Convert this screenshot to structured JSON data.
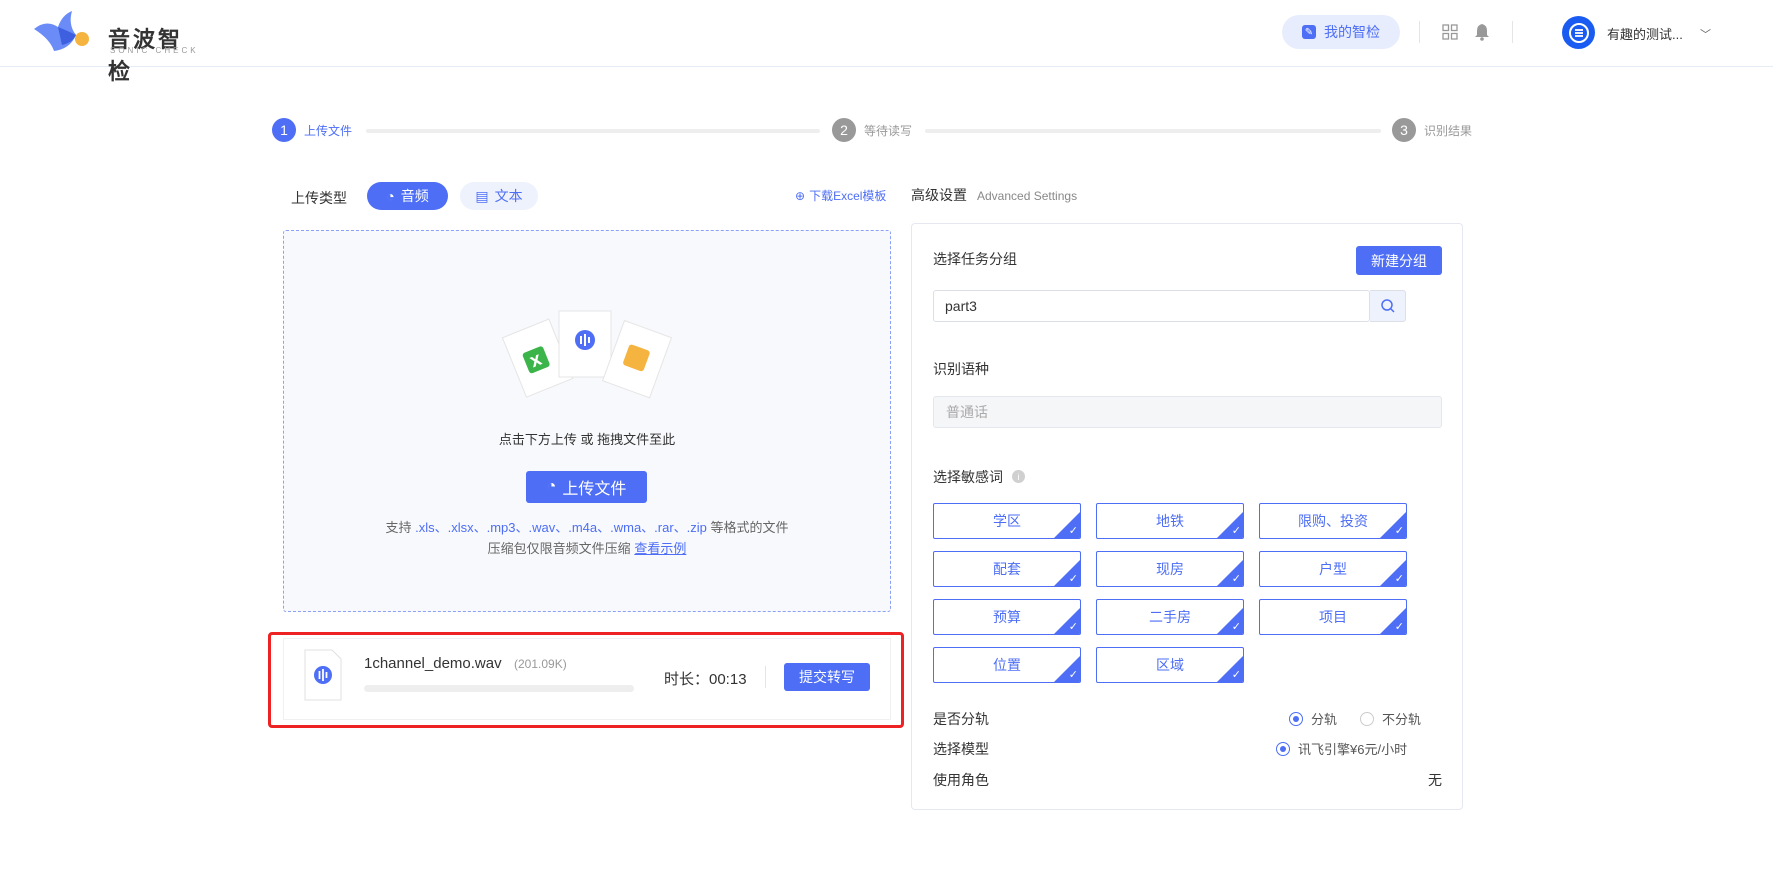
{
  "header": {
    "logo_title": "音波智检",
    "logo_subtitle": "SONIC CHECK",
    "my_button": "我的智检",
    "user_name": "有趣的测试..."
  },
  "steps": [
    {
      "num": "1",
      "label": "上传文件"
    },
    {
      "num": "2",
      "label": "等待读写"
    },
    {
      "num": "3",
      "label": "识别结果"
    }
  ],
  "upload": {
    "type_label": "上传类型",
    "type_audio": "音频",
    "type_text": "文本",
    "download_template": "下载Excel模板",
    "drop_hint": "点击下方上传 或 拖拽文件至此",
    "upload_button": "上传文件",
    "support_prefix": "支持",
    "support_formats": ".xls、.xlsx、.mp3、.wav、.m4a、.wma、.rar、.zip",
    "support_suffix": "等格式的文件",
    "compress_note": "压缩包仅限音频文件压缩",
    "view_example": "查看示例"
  },
  "file": {
    "name": "1channel_demo.wav",
    "size": "(201.09K)",
    "duration": "时长：00:13",
    "submit_button": "提交转写"
  },
  "advanced": {
    "title": "高级设置",
    "title_en": "Advanced Settings",
    "group_label": "选择任务分组",
    "new_group_button": "新建分组",
    "group_value": "part3",
    "lang_label": "识别语种",
    "lang_placeholder": "普通话",
    "sensitive_label": "选择敏感词",
    "tags": [
      "学区",
      "地铁",
      "限购、投资",
      "配套",
      "现房",
      "户型",
      "预算",
      "二手房",
      "项目",
      "位置",
      "区域"
    ],
    "split_label": "是否分轨",
    "split_on": "分轨",
    "split_off": "不分轨",
    "model_label": "选择模型",
    "model_value": "讯飞引擎¥6元/小时",
    "role_label": "使用角色",
    "role_value": "无"
  }
}
